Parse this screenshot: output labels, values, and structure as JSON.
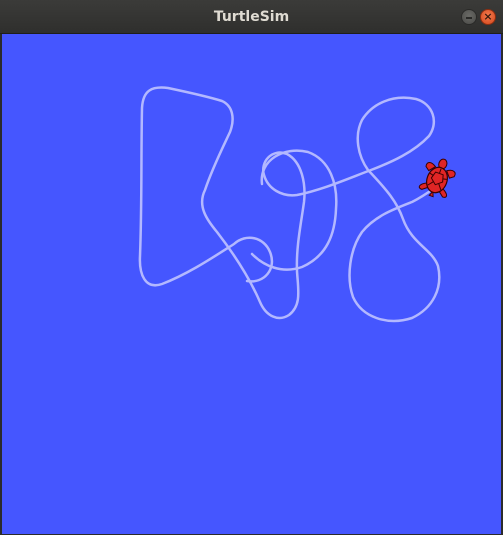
{
  "window": {
    "title": "TurtleSim",
    "close_glyph": "×",
    "background_color": "#4556ff",
    "pen_color": "#b3b8ff",
    "turtle_color": "#e02525"
  },
  "turtle": {
    "heading": "up-right"
  }
}
